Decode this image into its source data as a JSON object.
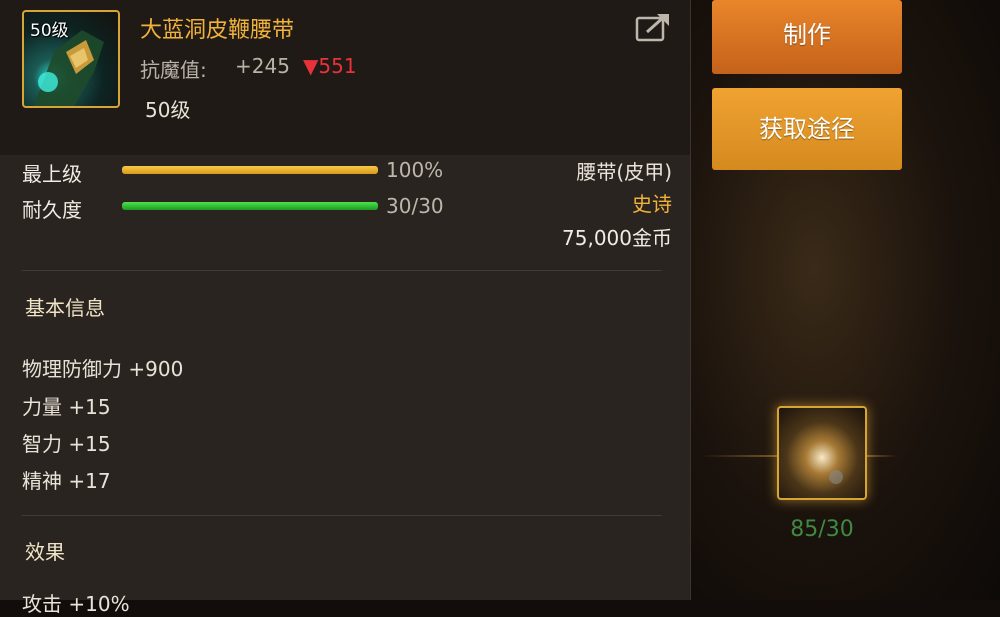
{
  "item": {
    "level_badge": "50级",
    "name": "大蓝洞皮鞭腰带",
    "resist_label": "抗魔值:",
    "resist_value": "+245",
    "resist_diff": "▼551",
    "required_level": "50级",
    "icon": "share-icon"
  },
  "stats": [
    {
      "label": "最上级",
      "value": "100%",
      "fill": 1.0,
      "color": "#f0b232"
    },
    {
      "label": "耐久度",
      "value": "30/30",
      "fill": 1.0,
      "color": "#33c233"
    }
  ],
  "meta": {
    "type": "腰带(皮甲)",
    "rarity": "史诗",
    "price": "75,000金币"
  },
  "basic_info": {
    "title": "基本信息",
    "attributes": [
      "物理防御力 +900",
      "力量 +15",
      "智力 +15",
      "精神 +17"
    ]
  },
  "effects": {
    "title": "效果",
    "partial_line": "攻击 +10%"
  },
  "actions": {
    "make_label": "制作",
    "source_label": "获取途径"
  },
  "material": {
    "count": "85/30"
  },
  "colors": {
    "accent": "#f0b23a",
    "danger": "#e8323a",
    "button_make": "#d8731f",
    "button_source": "#e89727",
    "count_green": "#3f8a40"
  }
}
